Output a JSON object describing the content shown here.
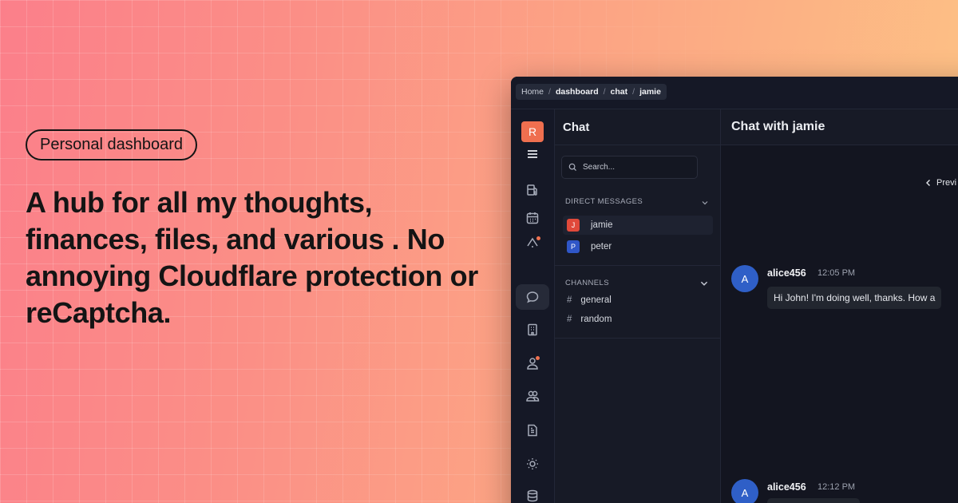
{
  "hero": {
    "tag": "Personal dashboard",
    "headline": "A hub for all my thoughts, finances, files, and various . No annoying Cloudflare protection or reCaptcha."
  },
  "breadcrumb": [
    "Home",
    "dashboard",
    "chat",
    "jamie"
  ],
  "rail": {
    "avatar_letter": "R",
    "icons": [
      "menu-icon",
      "fuel-icon",
      "calendar-icon",
      "notification-icon",
      "chat-icon",
      "building-icon",
      "user-icon",
      "users-icon",
      "document-icon",
      "sun-icon",
      "database-icon"
    ]
  },
  "sidebar": {
    "title": "Chat",
    "search_placeholder": "Search...",
    "direct_messages_title": "DIRECT MESSAGES",
    "direct_messages": [
      {
        "initial": "J",
        "name": "jamie",
        "color": "#e0493a"
      },
      {
        "initial": "P",
        "name": "peter",
        "color": "#2f56c7"
      }
    ],
    "channels_title": "CHANNELS",
    "channels": [
      {
        "hash": "#",
        "name": "general"
      },
      {
        "hash": "#",
        "name": "random"
      }
    ]
  },
  "main": {
    "title": "Chat with jamie",
    "prev_label": "Previ",
    "messages": [
      {
        "initial": "A",
        "author": "alice456",
        "time": "12:05 PM",
        "text": "Hi John! I'm doing well, thanks. How a"
      },
      {
        "initial": "A",
        "author": "alice456",
        "time": "12:12 PM",
        "text": ""
      }
    ]
  },
  "colors": {
    "accent": "#ef6f4f",
    "panel": "#131520",
    "avatar_blue": "#2f5fc7"
  }
}
